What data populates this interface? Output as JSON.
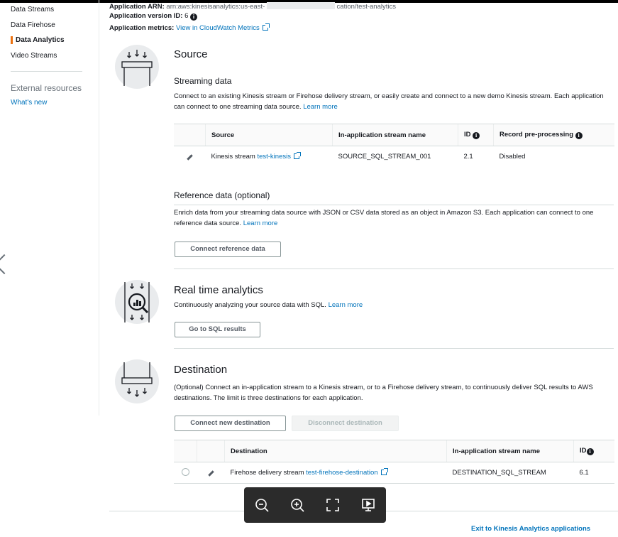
{
  "sidebar": {
    "items": [
      {
        "label": "Data Streams",
        "active": false
      },
      {
        "label": "Data Firehose",
        "active": false
      },
      {
        "label": "Data Analytics",
        "active": true
      },
      {
        "label": "Video Streams",
        "active": false
      }
    ],
    "external_heading": "External resources",
    "whats_new": "What's new"
  },
  "header": {
    "arn_label": "Application ARN:",
    "arn_value_start": "arn:aws:kinesisanalytics:us-east-",
    "arn_value_end": "cation/test-analytics",
    "version_label": "Application version ID:",
    "version_value": "6",
    "metrics_label": "Application metrics:",
    "metrics_link": "View in CloudWatch Metrics"
  },
  "source": {
    "title": "Source",
    "streaming_title": "Streaming data",
    "streaming_desc": "Connect to an existing Kinesis stream or Firehose delivery stream, or easily create and connect to a new demo Kinesis stream. Each application can connect to one streaming data source.",
    "learn_more": "Learn more",
    "table": {
      "headers": [
        "Source",
        "In-application stream name",
        "ID",
        "Record pre-processing"
      ],
      "row": {
        "source_prefix": "Kinesis stream",
        "source_link": "test-kinesis",
        "stream_name": "SOURCE_SQL_STREAM_001",
        "id": "2.1",
        "preprocessing": "Disabled"
      }
    },
    "reference_title": "Reference data (optional)",
    "reference_desc": "Enrich data from your streaming data source with JSON or CSV data stored as an object in Amazon S3. Each application can connect to one reference data source.",
    "reference_learn_more": "Learn more",
    "connect_reference_button": "Connect reference data"
  },
  "analytics": {
    "title": "Real time analytics",
    "desc": "Continuously analyzing your source data with SQL.",
    "learn_more": "Learn more",
    "sql_button": "Go to SQL results"
  },
  "destination": {
    "title": "Destination",
    "desc": "(Optional) Connect an in-application stream to a Kinesis stream, or to a Firehose delivery stream, to continuously deliver SQL results to AWS destinations. The limit is three destinations for each application.",
    "connect_button": "Connect new destination",
    "disconnect_button": "Disconnect destination",
    "table": {
      "headers": [
        "Destination",
        "In-application stream name",
        "ID"
      ],
      "row": {
        "dest_prefix": "Firehose delivery stream",
        "dest_link": "test-firehose-destination",
        "stream_name": "DESTINATION_SQL_STREAM",
        "id": "6.1"
      }
    }
  },
  "footer": {
    "exit_link": "Exit to Kinesis Analytics applications"
  },
  "icons": {
    "info": "info-icon",
    "external": "external-link-icon",
    "edit": "pencil-icon",
    "zoom_out": "zoom-out-icon",
    "zoom_in": "zoom-in-icon",
    "fit": "fit-screen-icon",
    "present": "presentation-icon"
  }
}
